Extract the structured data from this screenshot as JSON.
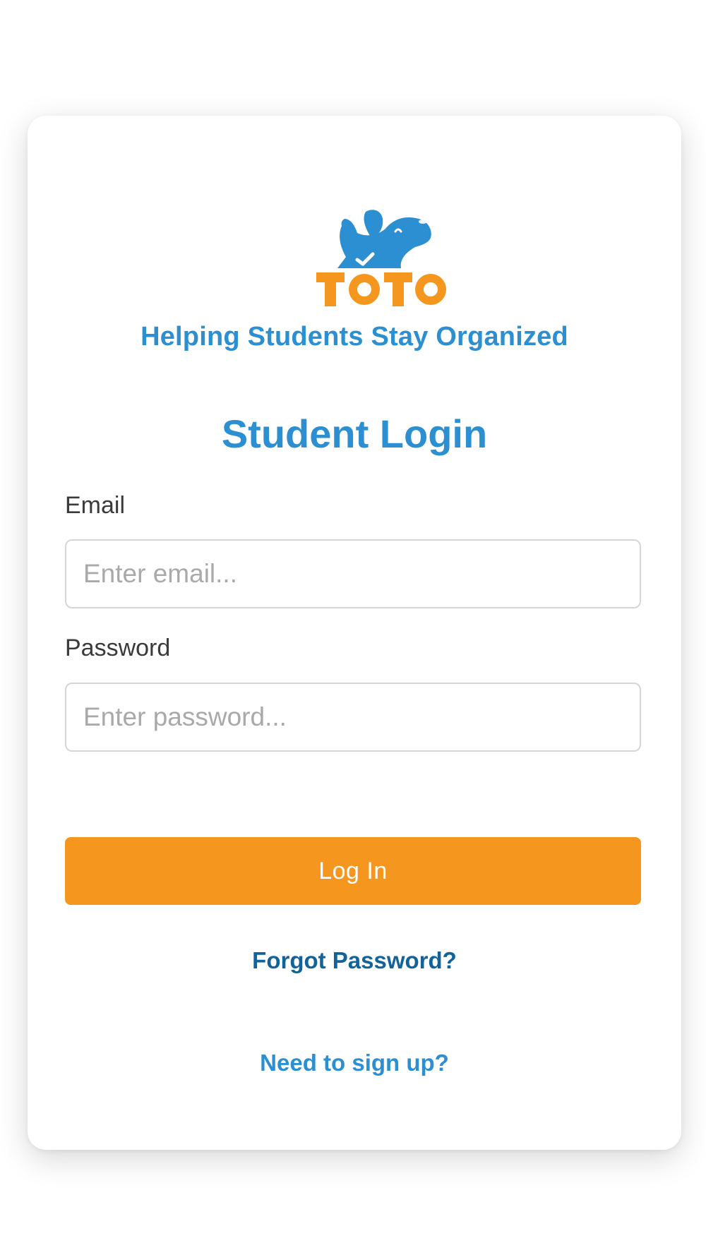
{
  "brand": {
    "logo_text": "TOTO",
    "tagline": "Helping Students Stay Organized",
    "colors": {
      "primary_blue": "#2b8fd1",
      "accent_orange": "#f5961e",
      "link_dark_blue": "#12639a"
    }
  },
  "login": {
    "heading": "Student Login",
    "email": {
      "label": "Email",
      "placeholder": "Enter email...",
      "value": ""
    },
    "password": {
      "label": "Password",
      "placeholder": "Enter password...",
      "value": ""
    },
    "submit_label": "Log In",
    "forgot_label": "Forgot Password?",
    "signup_label": "Need to sign up?"
  },
  "icons": {
    "logo": "dog-mascot-logo"
  }
}
